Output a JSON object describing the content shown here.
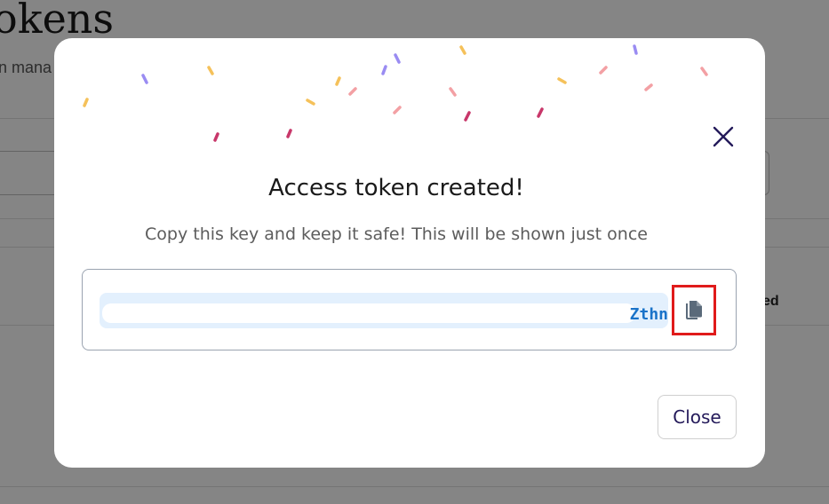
{
  "background": {
    "page_title": "okens",
    "page_subtitle": "n mana",
    "column_label": "ed"
  },
  "modal": {
    "title": "Access token created!",
    "subtitle": "Copy this key and keep it safe! This will be shown just once",
    "token_visible": "Zthn",
    "close_label": "Close",
    "icons": {
      "close": "close-x-icon",
      "copy": "copy-document-icon"
    },
    "colors": {
      "accent_text": "#241a5a",
      "token_text": "#1a73c9",
      "token_bg": "#e3f0fd",
      "highlight_border": "#e01b1b"
    }
  }
}
